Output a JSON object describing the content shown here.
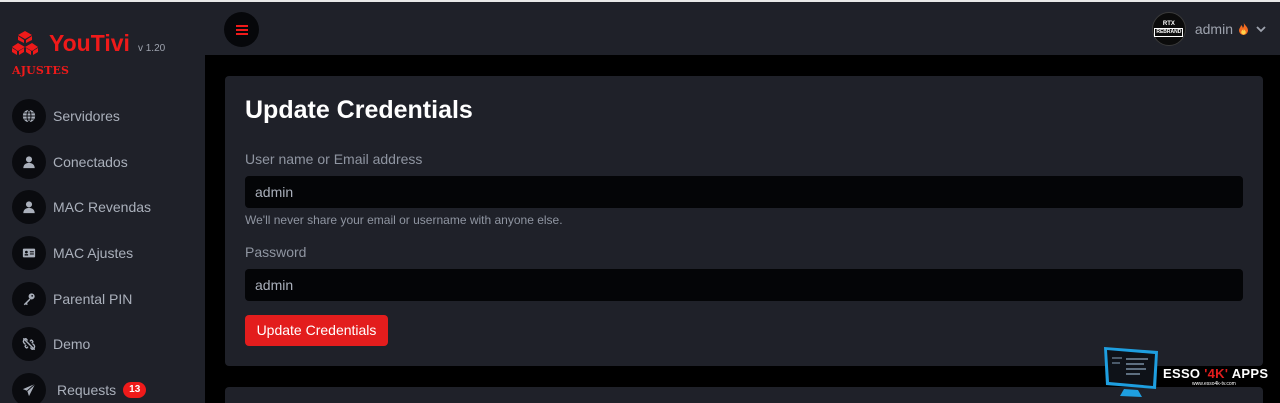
{
  "brand": {
    "name": "YouTivi",
    "version": "v 1.20",
    "section": "AJUSTES"
  },
  "sidebar": {
    "items": [
      {
        "label": "Servidores",
        "icon": "globe-icon"
      },
      {
        "label": "Conectados",
        "icon": "user-icon"
      },
      {
        "label": "MAC Revendas",
        "icon": "user-icon"
      },
      {
        "label": "MAC Ajustes",
        "icon": "id-card-icon"
      },
      {
        "label": "Parental PIN",
        "icon": "key-icon"
      },
      {
        "label": "Demo",
        "icon": "unlink-icon"
      },
      {
        "label": "Requests",
        "icon": "paper-plane-icon",
        "badge": "13"
      }
    ]
  },
  "header": {
    "user_name": "admin",
    "avatar_line1": "RTX",
    "avatar_line2": "REBRAND"
  },
  "form": {
    "title": "Update Credentials",
    "username_label": "User name or Email address",
    "username_value": "admin",
    "help_text": "We'll never share your email or username with anyone else.",
    "password_label": "Password",
    "password_value": "admin",
    "submit_label": "Update Credentials"
  },
  "watermark": {
    "prefix": "ESSO ",
    "highlight": "'4K'",
    "suffix": " APPS",
    "url": "www.esso4k-tv.com"
  },
  "colors": {
    "accent": "#ef1a1a",
    "sidebar_bg": "#1f2129",
    "card_bg": "#1f2129",
    "input_bg": "#040507",
    "page_bg": "#000000"
  }
}
